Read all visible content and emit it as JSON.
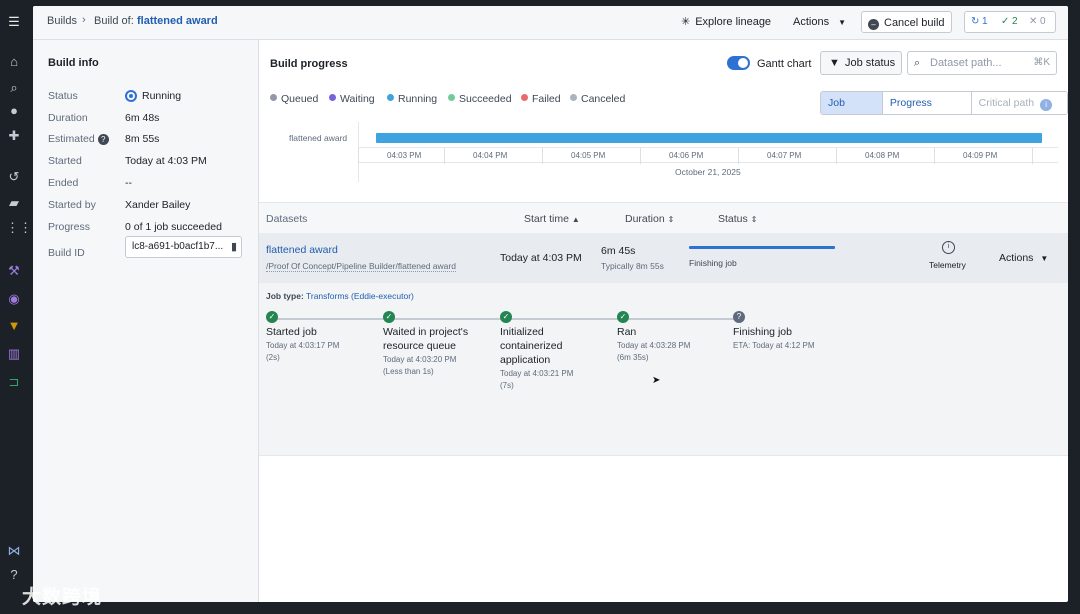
{
  "rail": {
    "icons": [
      "menu-expand-icon",
      "home-icon",
      "search-icon",
      "notifications-icon",
      "apps-icon",
      "recent-icon",
      "files-icon",
      "grid-icon",
      "hammer-icon",
      "inspect-icon",
      "filter-icon",
      "chart-icon",
      "pipeline-icon",
      "dna-icon",
      "help-icon"
    ]
  },
  "topbar": {
    "crumb_builds": "Builds",
    "crumb_build_of": "Build of:",
    "crumb_dataset": "flattened award",
    "explore_lineage": "Explore lineage",
    "actions": "Actions",
    "cancel_build": "Cancel build",
    "status_running": "1",
    "status_succeeded": "2",
    "status_failed": "0"
  },
  "build_info": {
    "title": "Build info",
    "status_label": "Status",
    "status_value": "Running",
    "duration_label": "Duration",
    "duration_value": "6m 48s",
    "estimated_label": "Estimated",
    "estimated_value": "8m 55s",
    "started_label": "Started",
    "started_value": "Today at 4:03 PM",
    "ended_label": "Ended",
    "ended_value": "--",
    "started_by_label": "Started by",
    "started_by_value": "Xander Bailey",
    "progress_label": "Progress",
    "progress_value": "0 of 1 job succeeded",
    "build_id_label": "Build ID",
    "build_id_value": "lc8-a691-b0acf1b7..."
  },
  "build_progress": {
    "title": "Build progress",
    "gantt_toggle_label": "Gantt chart",
    "gantt_on": true,
    "job_status_button": "Job status",
    "search_placeholder": "Dataset path...",
    "search_shortcut": "⌘K",
    "legend": [
      {
        "label": "Queued",
        "color": "#8f99a8"
      },
      {
        "label": "Waiting",
        "color": "#7961db"
      },
      {
        "label": "Running",
        "color": "#3ea3df"
      },
      {
        "label": "Succeeded",
        "color": "#72ca9b"
      },
      {
        "label": "Failed",
        "color": "#e76a6e"
      },
      {
        "label": "Canceled",
        "color": "#abb3bf"
      }
    ],
    "segments": {
      "job_status": "Job status",
      "progress_details": "Progress details",
      "critical_path": "Critical path"
    }
  },
  "gantt": {
    "row_label": "flattened award",
    "ticks": [
      "04:03 PM",
      "04:04 PM",
      "04:05 PM",
      "04:06 PM",
      "04:07 PM",
      "04:08 PM",
      "04:09 PM"
    ],
    "date": "October 21, 2025"
  },
  "table": {
    "headers": {
      "datasets": "Datasets",
      "start_time": "Start time",
      "duration": "Duration",
      "status": "Status"
    },
    "row": {
      "name": "flattened award",
      "path": "/Proof Of Concept/Pipeline Builder/flattened award",
      "start_time": "Today at 4:03 PM",
      "duration": "6m 45s",
      "typical": "Typically 8m 55s",
      "status": "Finishing job",
      "telemetry": "Telemetry",
      "actions": "Actions"
    }
  },
  "job": {
    "type_label": "Job type:",
    "type_value": "Transforms (Eddie-executor)",
    "steps": [
      {
        "title": "Started job",
        "time": "Today at 4:03:17 PM",
        "note": "(2s)"
      },
      {
        "title": "Waited in project's resource queue",
        "time": "Today at 4:03:20 PM",
        "note": "(Less than 1s)"
      },
      {
        "title": "Initialized containerized application",
        "time": "Today at 4:03:21 PM",
        "note": "(7s)"
      },
      {
        "title": "Ran",
        "time": "Today at 4:03:28 PM",
        "note": "(6m 35s)"
      },
      {
        "title": "Finishing job",
        "time": "ETA: Today at 4:12 PM",
        "note": ""
      }
    ]
  },
  "watermark": "大数跨境"
}
